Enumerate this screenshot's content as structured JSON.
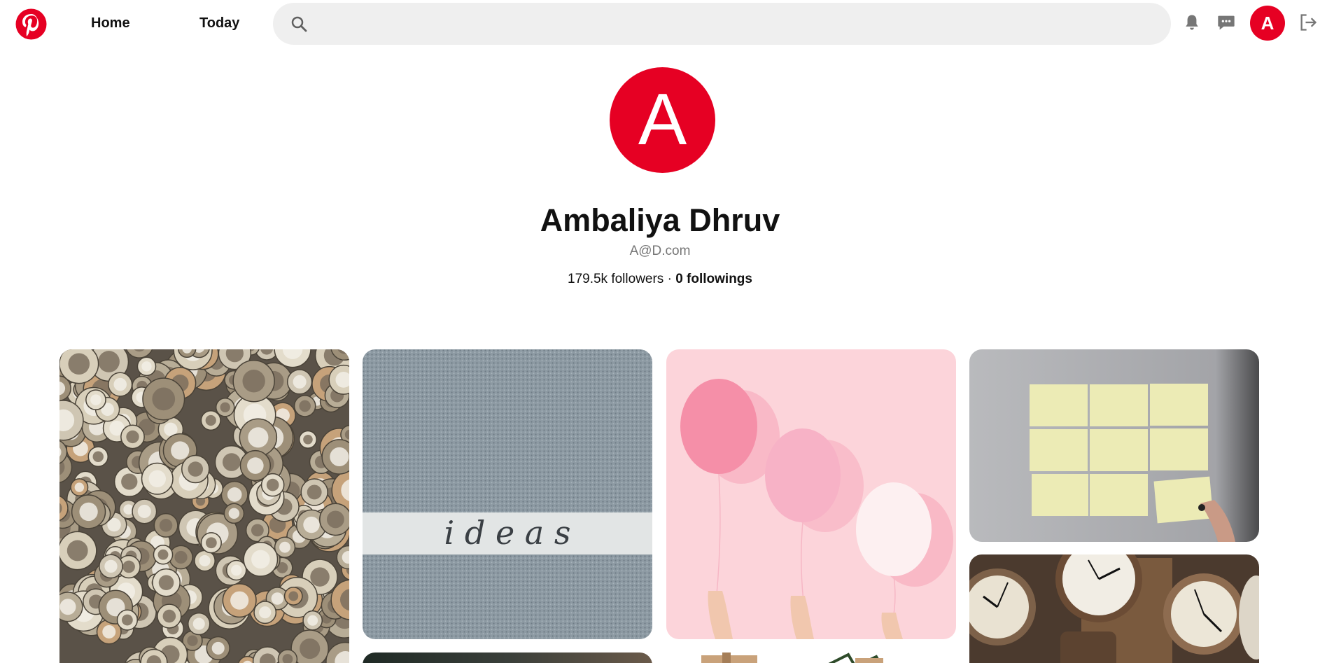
{
  "brand": {
    "name": "Pinterest",
    "color": "#e60023"
  },
  "nav": {
    "home": "Home",
    "today": "Today"
  },
  "search": {
    "value": "",
    "placeholder": "",
    "icon": "search-icon"
  },
  "header_icons": {
    "notifications": "bell-icon",
    "messages": "chat-icon",
    "logout": "logout-icon"
  },
  "user": {
    "initial": "A",
    "name": "Ambaliya Dhruv",
    "email": "A@D.com",
    "followers": "179.5k followers",
    "separator": " · ",
    "followings": "0 followings"
  },
  "pins": [
    {
      "subject": "vintage watch movements pile"
    },
    {
      "subject": "ideas written on pavement",
      "text": "i d e a s"
    },
    {
      "subject": "pink balloons held in hands"
    },
    {
      "subject": "sticky notes on wall"
    },
    {
      "subject": "antique clocks"
    },
    {
      "subject": "partial pin"
    },
    {
      "subject": "partial pin gifts"
    }
  ]
}
